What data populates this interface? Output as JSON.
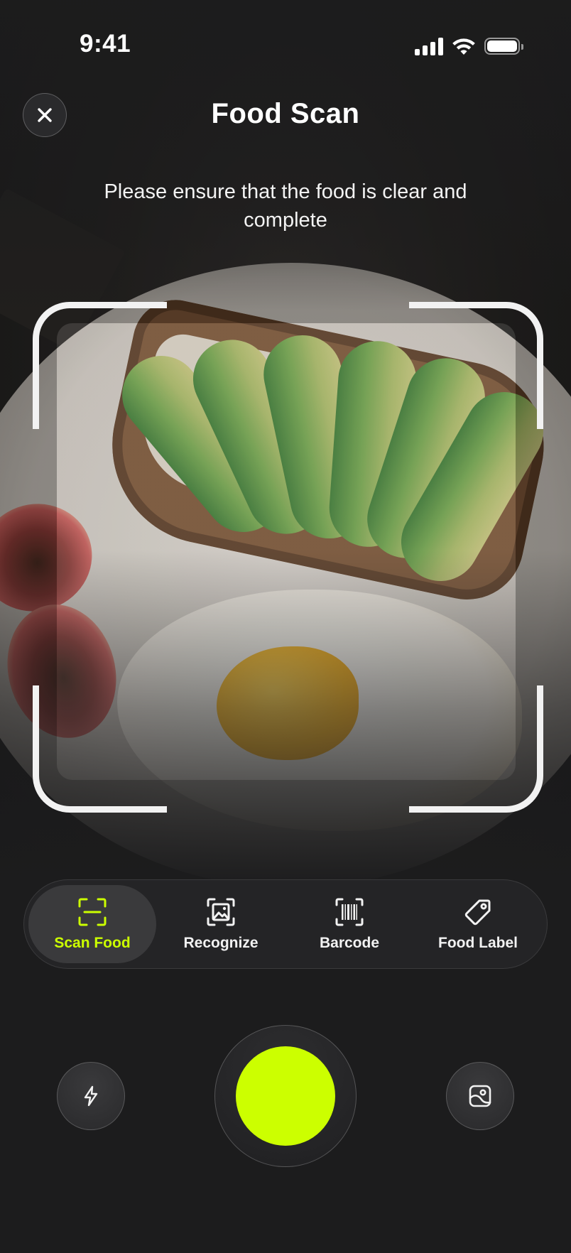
{
  "status_bar": {
    "time": "9:41",
    "icons": [
      "cellular-signal-icon",
      "wifi-icon",
      "battery-icon"
    ]
  },
  "header": {
    "title": "Food Scan",
    "close_icon": "close-icon"
  },
  "instruction": "Please ensure that the food is clear and complete",
  "modes": [
    {
      "label": "Scan Food",
      "icon": "scan-frame-icon",
      "active": true
    },
    {
      "label": "Recognize",
      "icon": "image-recognize-icon",
      "active": false
    },
    {
      "label": "Barcode",
      "icon": "barcode-icon",
      "active": false
    },
    {
      "label": "Food Label",
      "icon": "tag-icon",
      "active": false
    }
  ],
  "controls": {
    "flash_icon": "flash-icon",
    "gallery_icon": "gallery-icon",
    "shutter": "shutter-button"
  },
  "colors": {
    "accent": "#ccff00",
    "background": "#1c1c1d",
    "frame": "#f2f2f2",
    "text": "#ffffff"
  }
}
